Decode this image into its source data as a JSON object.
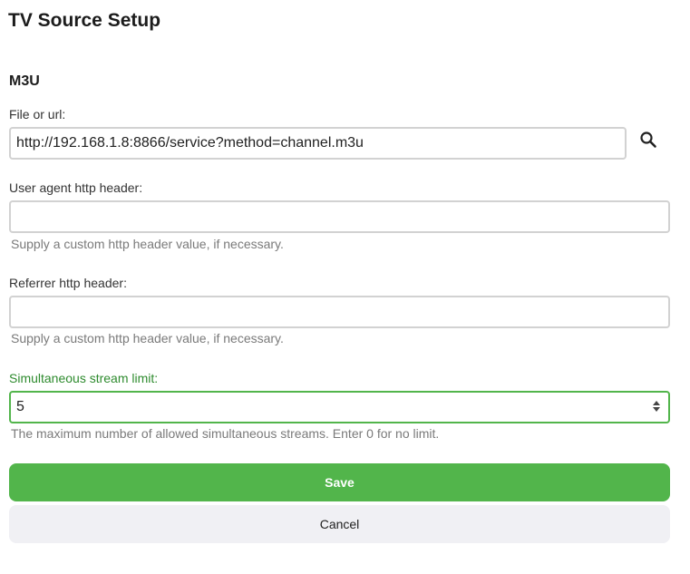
{
  "page": {
    "title": "TV Source Setup"
  },
  "section": {
    "title": "M3U"
  },
  "fields": {
    "file_or_url": {
      "label": "File or url:",
      "value": "http://192.168.1.8:8866/service?method=channel.m3u"
    },
    "user_agent": {
      "label": "User agent http header:",
      "value": "",
      "hint": "Supply a custom http header value, if necessary."
    },
    "referrer": {
      "label": "Referrer http header:",
      "value": "",
      "hint": "Supply a custom http header value, if necessary."
    },
    "stream_limit": {
      "label": "Simultaneous stream limit:",
      "value": "5",
      "hint": "The maximum number of allowed simultaneous streams. Enter 0 for no limit."
    }
  },
  "buttons": {
    "save_label": "Save",
    "cancel_label": "Cancel"
  },
  "icons": {
    "browse": "search-icon",
    "stepper": "number-stepper-icon"
  },
  "colors": {
    "accent": "#52b54b",
    "active_label": "#2e8b2e",
    "cancel_bg": "#f0f0f4"
  }
}
